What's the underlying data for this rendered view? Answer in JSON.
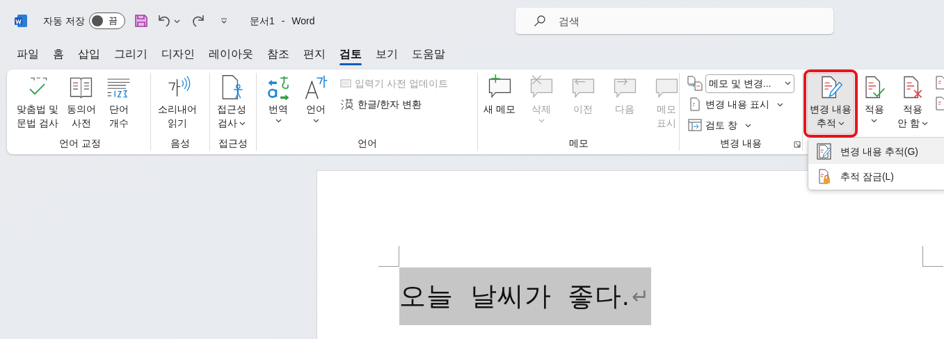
{
  "title_bar": {
    "autosave_label": "자동 저장",
    "autosave": {
      "on": false,
      "text": "끔"
    },
    "document_title": "문서1",
    "separator": "-",
    "app_name": "Word",
    "search": {
      "placeholder": "검색"
    }
  },
  "tabs": [
    {
      "label": "파일",
      "selected": false
    },
    {
      "label": "홈",
      "selected": false
    },
    {
      "label": "삽입",
      "selected": false
    },
    {
      "label": "그리기",
      "selected": false
    },
    {
      "label": "디자인",
      "selected": false
    },
    {
      "label": "레이아웃",
      "selected": false
    },
    {
      "label": "참조",
      "selected": false
    },
    {
      "label": "편지",
      "selected": false
    },
    {
      "label": "검토",
      "selected": true
    },
    {
      "label": "보기",
      "selected": false
    },
    {
      "label": "도움말",
      "selected": false
    }
  ],
  "ribbon": {
    "groups": [
      {
        "label": "언어 교정",
        "commands": [
          {
            "kind": "large",
            "label": "맞춤법 및\n문법 검사",
            "caret": false,
            "disabled": false
          },
          {
            "kind": "large",
            "label": "동의어\n사전",
            "caret": false,
            "disabled": false
          },
          {
            "kind": "large",
            "label": "단어\n개수",
            "caret": false,
            "disabled": false
          }
        ]
      },
      {
        "label": "음성",
        "commands": [
          {
            "kind": "large",
            "label": "소리내어\n읽기",
            "caret": false,
            "disabled": false
          }
        ]
      },
      {
        "label": "접근성",
        "commands": [
          {
            "kind": "large",
            "label": "접근성\n검사",
            "caret": true,
            "disabled": false
          }
        ]
      },
      {
        "label": "언어",
        "commands": [
          {
            "kind": "large",
            "label": "번역",
            "caret": true,
            "disabled": false
          },
          {
            "kind": "large",
            "label": "언어",
            "caret": true,
            "disabled": false
          },
          {
            "kind": "small",
            "label": "입력기 사전 업데이트",
            "caret": false,
            "disabled": true
          },
          {
            "kind": "small",
            "label": "한글/한자 변환",
            "caret": false,
            "disabled": false
          }
        ]
      },
      {
        "label": "메모",
        "commands": [
          {
            "kind": "large",
            "label": "새 메모",
            "caret": false,
            "disabled": false
          },
          {
            "kind": "large",
            "label": "삭제",
            "caret": true,
            "disabled": true
          },
          {
            "kind": "large",
            "label": "이전",
            "caret": false,
            "disabled": true
          },
          {
            "kind": "large",
            "label": "다음",
            "caret": false,
            "disabled": true
          },
          {
            "kind": "large",
            "label": "메모\n표시",
            "caret": false,
            "disabled": true
          }
        ]
      },
      {
        "label": "변경 내용",
        "dialog_launcher": true,
        "commands": [
          {
            "kind": "combo",
            "label": "메모 및 변경...",
            "caret": true,
            "disabled": false
          },
          {
            "kind": "small",
            "label": "변경 내용 표시",
            "caret": true,
            "disabled": false
          },
          {
            "kind": "small",
            "label": "검토 창",
            "caret": true,
            "disabled": false
          }
        ]
      },
      {
        "commands": [
          {
            "kind": "large",
            "label": "변경 내용\n추적",
            "caret": true,
            "disabled": false,
            "open": true,
            "outlined": true
          },
          {
            "kind": "large",
            "label": "적용",
            "caret": true,
            "disabled": false,
            "open": false,
            "outlined": false
          },
          {
            "kind": "large",
            "label": "적용\n안 함",
            "caret": true,
            "disabled": false,
            "open": false,
            "outlined": false
          }
        ]
      }
    ]
  },
  "dropdown_menu": {
    "items": [
      {
        "label": "변경 내용 추적(G)",
        "selected": true
      },
      {
        "label": "추적 잠금(L)",
        "selected": false
      }
    ]
  },
  "document": {
    "text": "오늘 날씨가 좋다.",
    "paragraph_mark": "↵",
    "selected": true
  }
}
